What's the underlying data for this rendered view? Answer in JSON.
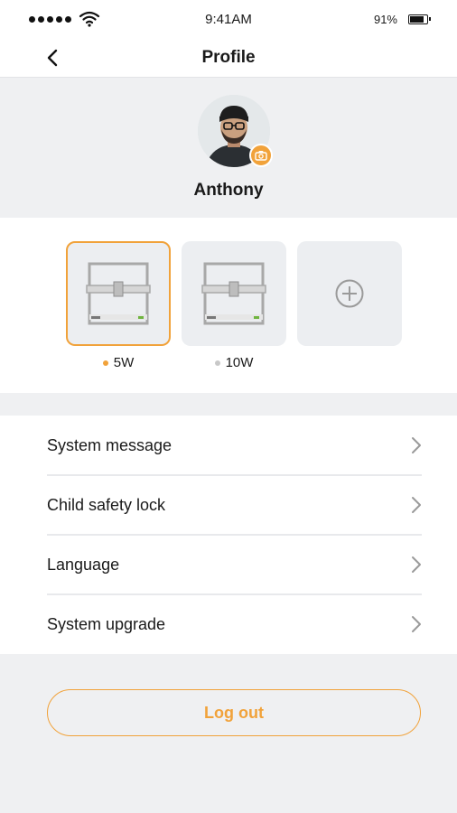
{
  "status_bar": {
    "time": "9:41AM",
    "battery_percent": "91%",
    "battery_level": 0.91,
    "signal_icon": "signal-dots-icon",
    "wifi_icon": "wifi-icon",
    "battery_icon": "battery-icon"
  },
  "nav": {
    "title": "Profile",
    "back_icon": "chevron-left-icon"
  },
  "profile": {
    "name": "Anthony",
    "avatar_icon": "avatar-photo",
    "camera_icon": "camera-icon"
  },
  "devices": {
    "items": [
      {
        "label": "5W",
        "selected": true,
        "dot_color": "#f1a23a"
      },
      {
        "label": "10W",
        "selected": false,
        "dot_color": "#c8c8c8"
      }
    ],
    "add_icon": "plus-circle-icon"
  },
  "menu": {
    "items": [
      {
        "label": "System message"
      },
      {
        "label": "Child safety lock"
      },
      {
        "label": "Language"
      },
      {
        "label": "System upgrade"
      }
    ],
    "chevron_icon": "chevron-right-icon"
  },
  "logout": {
    "label": "Log out"
  },
  "colors": {
    "accent": "#f1a23a",
    "background": "#eff0f2",
    "card": "#eceef1",
    "text": "#1a1a1a"
  }
}
